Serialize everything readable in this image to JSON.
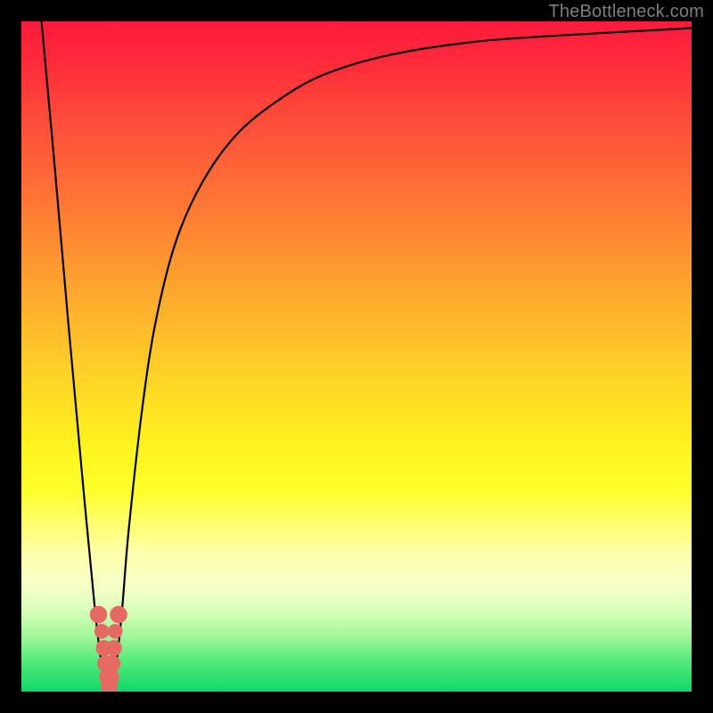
{
  "watermark": "TheBottleneck.com",
  "chart_data": {
    "type": "line",
    "title": "",
    "xlabel": "",
    "ylabel": "",
    "xlim": [
      0,
      100
    ],
    "ylim": [
      0,
      100
    ],
    "background_gradient": {
      "direction": "vertical",
      "stops": [
        {
          "pos": 0,
          "color": "#ff1a3d"
        },
        {
          "pos": 50,
          "color": "#ffd028"
        },
        {
          "pos": 70,
          "color": "#ffff2a"
        },
        {
          "pos": 100,
          "color": "#0fd868"
        }
      ]
    },
    "series": [
      {
        "name": "bottleneck-curve",
        "x": [
          3,
          5,
          7,
          9,
          11,
          12,
          13,
          14,
          15,
          16,
          18,
          20,
          23,
          27,
          32,
          38,
          45,
          55,
          68,
          82,
          100
        ],
        "values": [
          100,
          78,
          55,
          33,
          12,
          4,
          0,
          3,
          12,
          24,
          42,
          55,
          67,
          76,
          83,
          88,
          92,
          95,
          97,
          98,
          99
        ]
      }
    ],
    "markers": [
      {
        "x": 11.5,
        "y": 11.5,
        "r": 1.3
      },
      {
        "x": 14.5,
        "y": 11.5,
        "r": 1.3
      },
      {
        "x": 12.0,
        "y": 9.0,
        "r": 1.1
      },
      {
        "x": 14.0,
        "y": 9.0,
        "r": 1.1
      },
      {
        "x": 12.3,
        "y": 6.5,
        "r": 1.2
      },
      {
        "x": 13.8,
        "y": 6.5,
        "r": 1.2
      },
      {
        "x": 12.5,
        "y": 4.2,
        "r": 1.2
      },
      {
        "x": 13.6,
        "y": 4.2,
        "r": 1.2
      },
      {
        "x": 12.9,
        "y": 2.2,
        "r": 1.3
      },
      {
        "x": 13.3,
        "y": 2.2,
        "r": 1.3
      },
      {
        "x": 13.1,
        "y": 0.8,
        "r": 1.3
      }
    ]
  }
}
